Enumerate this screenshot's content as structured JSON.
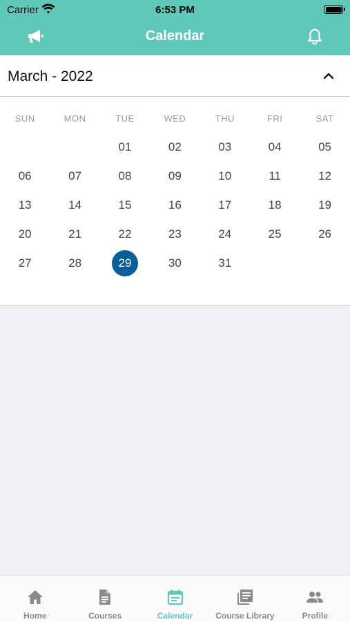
{
  "status_bar": {
    "carrier": "Carrier",
    "time": "6:53 PM"
  },
  "nav": {
    "title": "Calendar",
    "left_icon": "megaphone-icon",
    "right_icon": "bell-icon"
  },
  "month_header": {
    "label": "March - 2022",
    "toggle_icon": "chevron-up-icon"
  },
  "calendar": {
    "weekdays": [
      "SUN",
      "MON",
      "TUE",
      "WED",
      "THU",
      "FRI",
      "SAT"
    ],
    "weeks": [
      [
        "",
        "",
        "01",
        "02",
        "03",
        "04",
        "05"
      ],
      [
        "06",
        "07",
        "08",
        "09",
        "10",
        "11",
        "12"
      ],
      [
        "13",
        "14",
        "15",
        "16",
        "17",
        "18",
        "19"
      ],
      [
        "20",
        "21",
        "22",
        "23",
        "24",
        "25",
        "26"
      ],
      [
        "27",
        "28",
        "29",
        "30",
        "31",
        "",
        ""
      ]
    ],
    "selected": "29",
    "selected_color": "#0a5e9c"
  },
  "colors": {
    "accent": "#5fc8b8",
    "inactive_tab": "#8a8a8a"
  },
  "tabbar": {
    "items": [
      {
        "label": "Home",
        "icon": "home-icon"
      },
      {
        "label": "Courses",
        "icon": "document-icon"
      },
      {
        "label": "Calendar",
        "icon": "calendar-icon",
        "active": true
      },
      {
        "label": "Course Library",
        "icon": "library-icon"
      },
      {
        "label": "Profile",
        "icon": "people-icon"
      }
    ]
  }
}
